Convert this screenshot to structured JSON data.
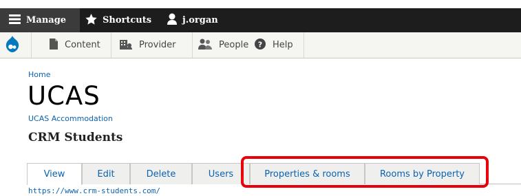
{
  "toolbar": {
    "manage": "Manage",
    "shortcuts": "Shortcuts",
    "user": "j.organ"
  },
  "tray": {
    "content": "Content",
    "provider": "Provider",
    "people": "People",
    "help": "Help"
  },
  "breadcrumb": "Home",
  "logo_text": "UCAS",
  "site_name": "UCAS Accommodation",
  "page_title": "CRM Students",
  "tabs": [
    {
      "label": "View"
    },
    {
      "label": "Edit"
    },
    {
      "label": "Delete"
    },
    {
      "label": "Users"
    },
    {
      "label": "Properties & rooms"
    },
    {
      "label": "Rooms by Property"
    }
  ],
  "url": "https://www.crm-students.com/",
  "colors": {
    "link": "#0a62b0",
    "toolbar": "#1d1d1d",
    "highlight": "#e8000b"
  }
}
